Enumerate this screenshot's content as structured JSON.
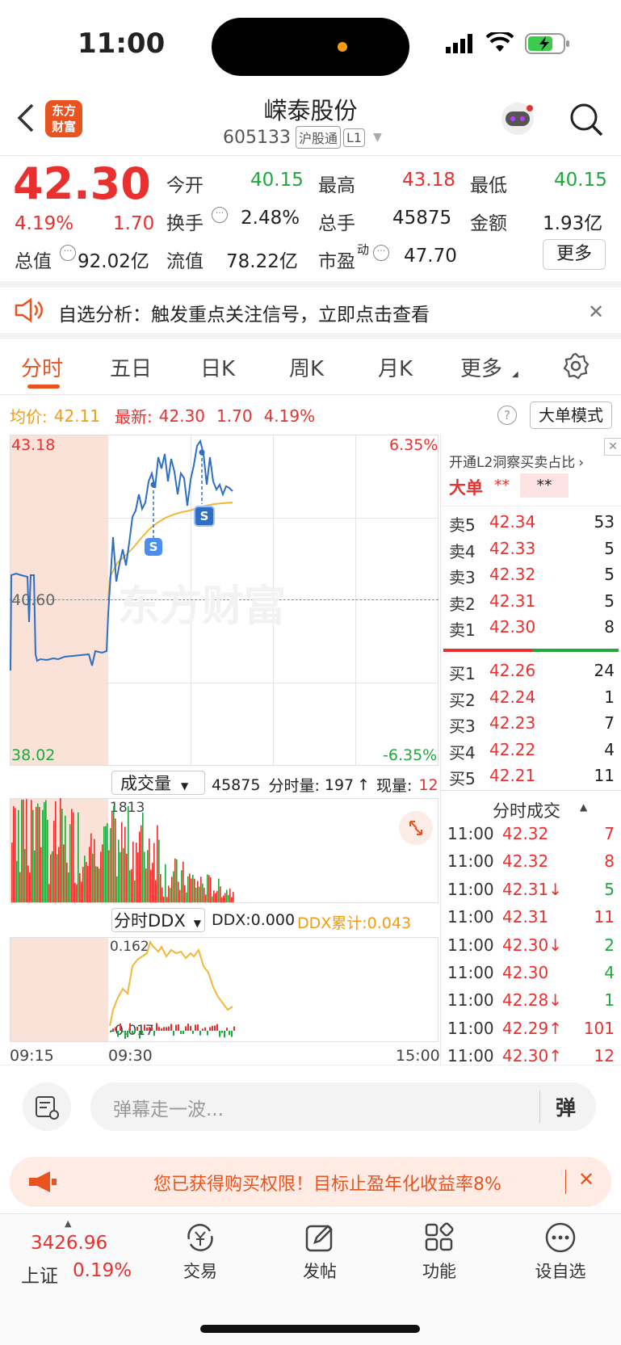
{
  "status_bar": {
    "time": "11:00"
  },
  "header": {
    "logo_text_1": "东方",
    "logo_text_2": "财富",
    "stock_name": "嵘泰股份",
    "stock_code": "605133",
    "tag_market": "沪股通",
    "tag_level": "L1"
  },
  "quote": {
    "price": "42.30",
    "change_pct": "4.19%",
    "change": "1.70",
    "open_label": "今开",
    "open": "40.15",
    "high_label": "最高",
    "high": "43.18",
    "low_label": "最低",
    "low": "40.15",
    "turnover_label": "换手",
    "turnover": "2.48%",
    "volume_label": "总手",
    "volume": "45875",
    "amount_label": "金额",
    "amount": "1.93亿",
    "mcap_label": "总值",
    "mcap": "92.02亿",
    "float_label": "流值",
    "float": "78.22亿",
    "pe_label": "市盈",
    "pe_sup": "动",
    "pe": "47.70",
    "more_button": "更多"
  },
  "notice": {
    "text": "自选分析：触发重点关注信号，立即点击查看"
  },
  "tabs": [
    "分时",
    "五日",
    "日K",
    "周K",
    "月K",
    "更多"
  ],
  "chart_info": {
    "avg_label": "均价:",
    "avg_value": "42.11",
    "latest_label": "最新:",
    "latest_value": "42.30",
    "latest_change": "1.70",
    "latest_pct": "4.19%",
    "mode_button": "大单模式",
    "y_top": "43.18",
    "y_mid": "40.60",
    "y_bottom": "38.02",
    "pct_top": "6.35%",
    "pct_bottom": "-6.35%",
    "watermark": "东方财富",
    "marker_s": "S"
  },
  "volume_bar": {
    "selector": "成交量",
    "total": "45875",
    "fenshi_label": "分时量:",
    "fenshi_value": "197",
    "now_label": "现量:",
    "now_value": "12",
    "max_label": "1813"
  },
  "ddx_bar": {
    "selector": "分时DDX",
    "ddx": "DDX:0.000",
    "ddx_cum": "DDX累计:0.043",
    "max_label": "0.162",
    "min_label": "-0.017"
  },
  "time_axis": {
    "start": "09:15",
    "open": "09:30",
    "end": "15:00"
  },
  "order_book": {
    "promo": "开通L2洞察买卖占比",
    "big_label": "大单",
    "big_value1": "**",
    "big_value2": "**",
    "asks": [
      {
        "label": "卖5",
        "price": "42.34",
        "vol": "53"
      },
      {
        "label": "卖4",
        "price": "42.33",
        "vol": "5"
      },
      {
        "label": "卖3",
        "price": "42.32",
        "vol": "5"
      },
      {
        "label": "卖2",
        "price": "42.31",
        "vol": "5"
      },
      {
        "label": "卖1",
        "price": "42.30",
        "vol": "8"
      }
    ],
    "bids": [
      {
        "label": "买1",
        "price": "42.26",
        "vol": "24"
      },
      {
        "label": "买2",
        "price": "42.24",
        "vol": "1"
      },
      {
        "label": "买3",
        "price": "42.23",
        "vol": "7"
      },
      {
        "label": "买4",
        "price": "42.22",
        "vol": "4"
      },
      {
        "label": "买5",
        "price": "42.21",
        "vol": "11"
      }
    ]
  },
  "trades": {
    "title": "分时成交",
    "rows": [
      {
        "time": "11:00",
        "price": "42.32",
        "vol": "7",
        "color": "#e8312f",
        "vcolor": "#e8312f"
      },
      {
        "time": "11:00",
        "price": "42.32",
        "vol": "8",
        "color": "#e8312f",
        "vcolor": "#e8312f"
      },
      {
        "time": "11:00",
        "price": "42.31↓",
        "vol": "5",
        "color": "#e8312f",
        "vcolor": "#1fa83c"
      },
      {
        "time": "11:00",
        "price": "42.31",
        "vol": "11",
        "color": "#e8312f",
        "vcolor": "#e8312f"
      },
      {
        "time": "11:00",
        "price": "42.30↓",
        "vol": "2",
        "color": "#e8312f",
        "vcolor": "#1fa83c"
      },
      {
        "time": "11:00",
        "price": "42.30",
        "vol": "4",
        "color": "#e8312f",
        "vcolor": "#1fa83c"
      },
      {
        "time": "11:00",
        "price": "42.28↓",
        "vol": "1",
        "color": "#e8312f",
        "vcolor": "#1fa83c"
      },
      {
        "time": "11:00",
        "price": "42.29↑",
        "vol": "101",
        "color": "#e8312f",
        "vcolor": "#e8312f"
      },
      {
        "time": "11:00",
        "price": "42.30↑",
        "vol": "12",
        "color": "#e8312f",
        "vcolor": "#e8312f"
      }
    ]
  },
  "comment": {
    "placeholder": "弹幕走一波...",
    "danmu_button": "弹"
  },
  "promo_banner": {
    "text": "您已获得购买权限！目标止盈年化收益率8%"
  },
  "bottom_nav": {
    "index_value": "3426.96",
    "index_name": "上证",
    "index_pct": "0.19%",
    "items": [
      "交易",
      "发帖",
      "功能",
      "设自选"
    ]
  },
  "colors": {
    "up": "#e8312f",
    "down": "#1fa83c",
    "avg": "#f5b638",
    "price_line": "#2e6fc4",
    "accent": "#e9531f"
  }
}
